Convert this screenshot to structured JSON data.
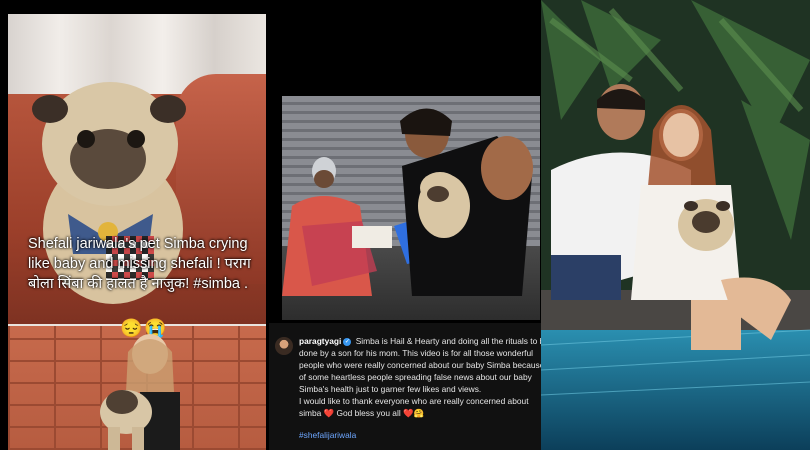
{
  "left_panel": {
    "overlay_text": "Shefali jariwala's pet Simba crying like baby and missing shefali ! पराग बोला सिंबा की हालत है नाजुक! #simba .",
    "emojis": "😔😭"
  },
  "caption": {
    "username": "paragtyagi",
    "verified_icon": "verified-badge-icon",
    "text_1": "Simba is Hail & Hearty and doing all the rituals to be done by a son for his mom. This video is for all those wonderful people who were really concerned about our baby Simba because of some heartless people spreading false news about our baby Simba's health just to garner few likes and views.",
    "text_2": "I would like to thank everyone who are really concerned about simba",
    "heart": "❤️",
    "text_3": "God bless you all",
    "emoji_end": "❤️🤗",
    "hashtag": "#shefalijariwala"
  },
  "colors": {
    "background": "#000000",
    "hashtag": "#6ea7ff",
    "verified": "#3897f0"
  }
}
